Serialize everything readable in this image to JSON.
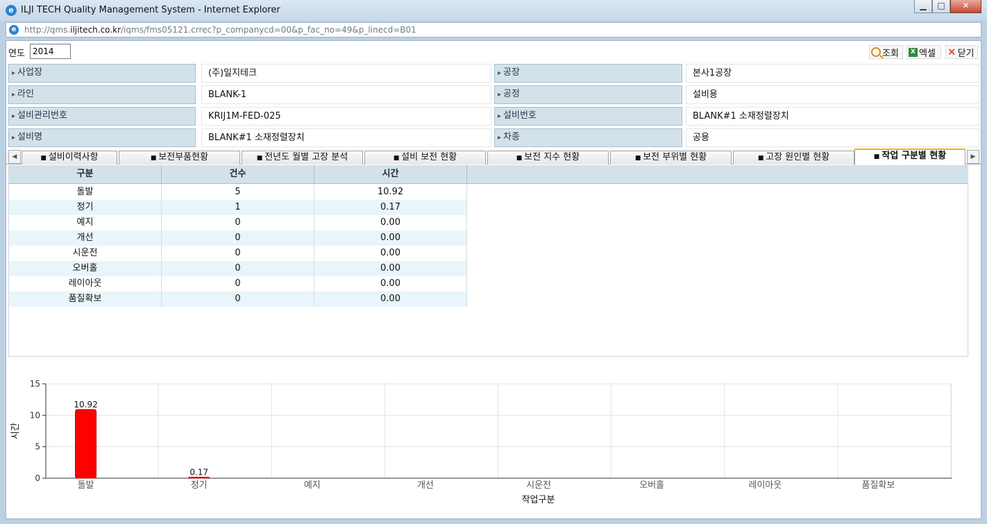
{
  "window": {
    "title": "ILJI TECH Quality Management System - Internet Explorer",
    "url_prefix": "http://qms.",
    "url_host": "iljitech.co.kr",
    "url_path": "/iqms/fms05121.crrec?p_companycd=00&p_fac_no=49&p_linecd=B01"
  },
  "toolbar": {
    "year_label": "연도",
    "year_value": "2014",
    "search_label": "조회",
    "excel_label": "엑셀",
    "close_label": "닫기"
  },
  "info": [
    {
      "label1": "사업장",
      "value1": "(주)일지테크",
      "label2": "공장",
      "value2": "본사1공장"
    },
    {
      "label1": "라인",
      "value1": "BLANK-1",
      "label2": "공정",
      "value2": "설비용"
    },
    {
      "label1": "설비관리번호",
      "value1": "KRIJ1M-FED-025",
      "label2": "설비번호",
      "value2": "BLANK#1 소재정렬장치"
    },
    {
      "label1": "설비명",
      "value1": "BLANK#1 소재정렬장치",
      "label2": "차종",
      "value2": "공용"
    }
  ],
  "tabs": [
    "설비이력사항",
    "보전부품현황",
    "전년도 월별 고장 분석",
    "설비 보전 현황",
    "보전 지수 현황",
    "보전 부위별 현황",
    "고장 원인별 현황",
    "작업 구분별 현황"
  ],
  "active_tab": 7,
  "table": {
    "headers": [
      "구분",
      "건수",
      "시간"
    ],
    "rows": [
      [
        "돌발",
        "5",
        "10.92"
      ],
      [
        "정기",
        "1",
        "0.17"
      ],
      [
        "예지",
        "0",
        "0.00"
      ],
      [
        "개선",
        "0",
        "0.00"
      ],
      [
        "시운전",
        "0",
        "0.00"
      ],
      [
        "오버홀",
        "0",
        "0.00"
      ],
      [
        "레이아웃",
        "0",
        "0.00"
      ],
      [
        "품질확보",
        "0",
        "0.00"
      ]
    ]
  },
  "chart_data": {
    "type": "bar",
    "categories": [
      "돌발",
      "정기",
      "예지",
      "개선",
      "시운전",
      "오버홀",
      "레이아웃",
      "품질확보"
    ],
    "values": [
      10.92,
      0.17,
      0,
      0,
      0,
      0,
      0,
      0
    ],
    "data_labels": [
      "10.92",
      "0.17",
      "",
      "",
      "",
      "",
      "",
      ""
    ],
    "xlabel": "작업구분",
    "ylabel": "시간",
    "ylim": [
      0,
      15
    ],
    "yticks": [
      0,
      5,
      10,
      15
    ],
    "grid": true,
    "bar_color": "#ff0000"
  }
}
